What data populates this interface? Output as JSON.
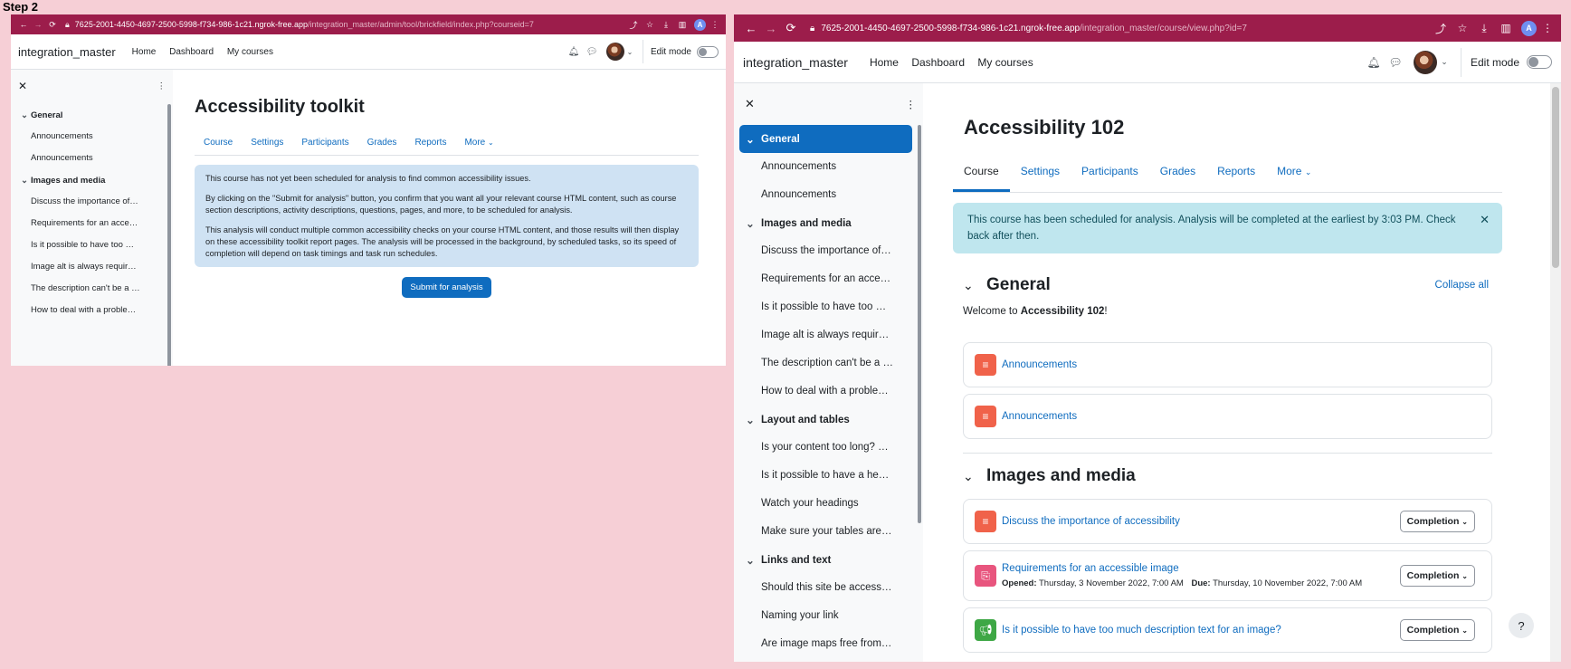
{
  "step_label": "Step 2",
  "left": {
    "url_host": "7625-2001-4450-4697-2500-5998-f734-986-1c21.ngrok-free.app",
    "url_path": "/integration_master/admin/tool/brickfield/index.php?courseid=7",
    "profile_letter": "A",
    "brand": "integration_master",
    "nav": [
      "Home",
      "Dashboard",
      "My courses"
    ],
    "edit_mode": "Edit mode",
    "sections": [
      {
        "title": "General",
        "items": [
          "Announcements",
          "Announcements"
        ]
      },
      {
        "title": "Images and media",
        "items": [
          "Discuss the importance of…",
          "Requirements for an acce…",
          "Is it possible to have too …",
          "Image alt is always requir…",
          "The description can't be a …",
          "How to deal with a proble…"
        ]
      }
    ],
    "page_title": "Accessibility toolkit",
    "tabs": [
      "Course",
      "Settings",
      "Participants",
      "Grades",
      "Reports",
      "More"
    ],
    "info": [
      "This course has not yet been scheduled for analysis to find common accessibility issues.",
      "By clicking on the \"Submit for analysis\" button, you confirm that you want all your relevant course HTML content, such as course section descriptions, activity descriptions, questions, pages, and more, to be scheduled for analysis.",
      "This analysis will conduct multiple common accessibility checks on your course HTML content, and those results will then display on these accessibility toolkit report pages. The analysis will be processed in the background, by scheduled tasks, so its speed of completion will depend on task timings and task run schedules."
    ],
    "submit_button": "Submit for analysis"
  },
  "right": {
    "url_host": "7625-2001-4450-4697-2500-5998-f734-986-1c21.ngrok-free.app",
    "url_path": "/integration_master/course/view.php?id=7",
    "profile_letter": "A",
    "brand": "integration_master",
    "nav": [
      "Home",
      "Dashboard",
      "My courses"
    ],
    "edit_mode": "Edit mode",
    "sections": [
      {
        "title": "General",
        "items": [
          "Announcements",
          "Announcements"
        ]
      },
      {
        "title": "Images and media",
        "items": [
          "Discuss the importance of…",
          "Requirements for an acce…",
          "Is it possible to have too …",
          "Image alt is always requir…",
          "The description can't be a …",
          "How to deal with a proble…"
        ]
      },
      {
        "title": "Layout and tables",
        "items": [
          "Is your content too long? …",
          "Is it possible to have a he…",
          "Watch your headings",
          "Make sure your tables are…"
        ]
      },
      {
        "title": "Links and text",
        "items": [
          "Should this site be access…",
          "Naming your link",
          "Are image maps free from…"
        ]
      }
    ],
    "page_title": "Accessibility 102",
    "tabs": [
      "Course",
      "Settings",
      "Participants",
      "Grades",
      "Reports",
      "More"
    ],
    "alert": "This course has been scheduled for analysis. Analysis will be completed at the earliest by 3:03 PM. Check back after then.",
    "general_heading": "General",
    "collapse_all": "Collapse all",
    "welcome_prefix": "Welcome to ",
    "welcome_course": "Accessibility 102",
    "welcome_suffix": "!",
    "general_activities": [
      "Announcements",
      "Announcements"
    ],
    "images_heading": "Images and media",
    "images_activities": [
      {
        "name": "Discuss the importance of accessibility",
        "color": "#f0624a",
        "icon": "forum-icon"
      },
      {
        "name": "Requirements for an accessible image",
        "color": "#e8557e",
        "icon": "assignment-icon",
        "opened_label": "Opened:",
        "opened": "Thursday, 3 November 2022, 7:00 AM",
        "due_label": "Due:",
        "due": "Thursday, 10 November 2022, 7:00 AM"
      },
      {
        "name": "Is it possible to have too much description text for an image?",
        "color": "#3ea745",
        "icon": "feedback-icon"
      }
    ],
    "completion_label": "Completion",
    "help": "?"
  }
}
